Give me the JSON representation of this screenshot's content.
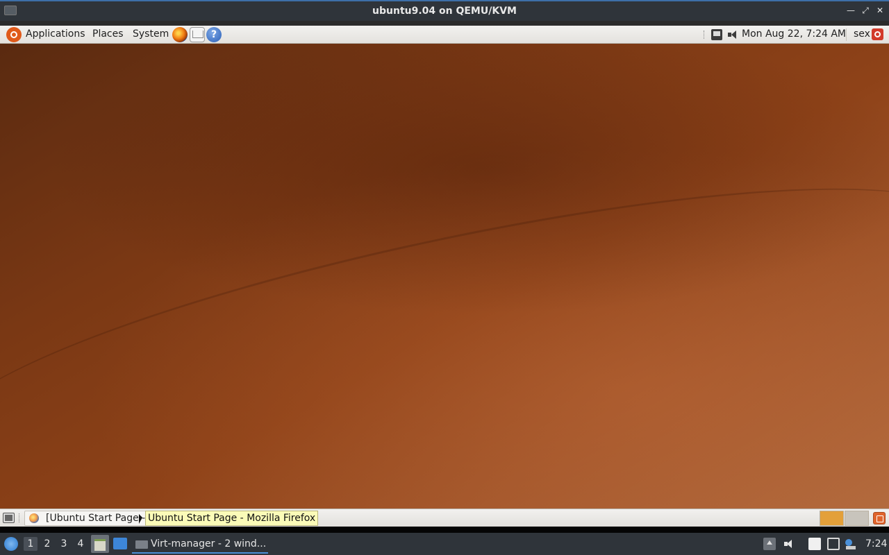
{
  "host_window": {
    "title": "ubuntu9.04 on QEMU/KVM"
  },
  "guest_top_panel": {
    "menus": [
      "Applications",
      "Places",
      "System"
    ],
    "clock": "Mon Aug 22,  7:24 AM",
    "user": "sex"
  },
  "guest_bottom_panel": {
    "task_label": "[Ubuntu Start Page - M",
    "tooltip": "Ubuntu Start Page - Mozilla Firefox"
  },
  "host_taskbar": {
    "desktops": [
      "1",
      "2",
      "3",
      "4"
    ],
    "active_desktop": "1",
    "task_label": "Virt-manager - 2 wind...",
    "clock": "7:24"
  },
  "colors": {
    "panel_bg": "#ecebe8",
    "host_bar_bg": "#2f343a",
    "wallpaper_accent": "#8e4218",
    "tooltip_bg": "#fbfbb8"
  }
}
